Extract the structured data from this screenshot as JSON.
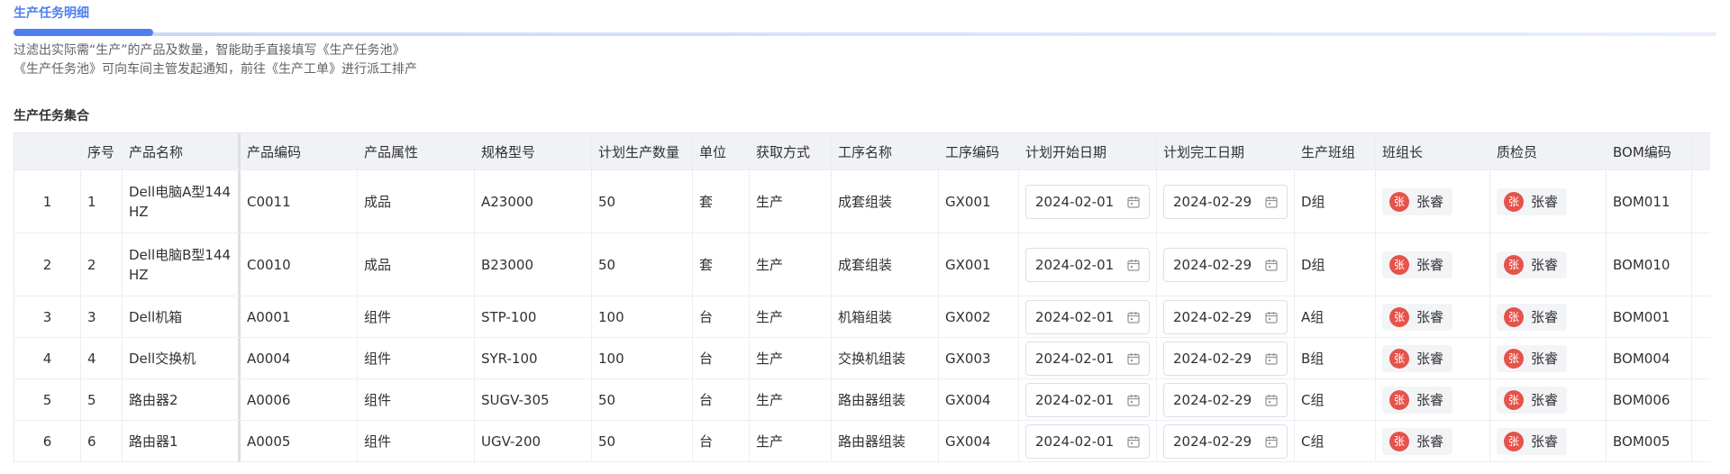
{
  "tab": {
    "title": "生产任务明细"
  },
  "description": {
    "line1": "过滤出实际需“生产”的产品及数量，智能助手直接填写《生产任务池》",
    "line2": "《生产任务池》可向车间主管发起通知，前往《生产工单》进行派工排产"
  },
  "section": {
    "title": "生产任务集合"
  },
  "table": {
    "headers": {
      "index": "",
      "seq": "序号",
      "product_name": "产品名称",
      "product_code": "产品编码",
      "product_attr": "产品属性",
      "spec": "规格型号",
      "plan_qty": "计划生产数量",
      "unit": "单位",
      "acquire": "获取方式",
      "process_name": "工序名称",
      "process_code": "工序编码",
      "plan_start": "计划开始日期",
      "plan_end": "计划完工日期",
      "team": "生产班组",
      "leader": "班组长",
      "inspector": "质检员",
      "bom": "BOM编码"
    },
    "rows": [
      {
        "index": "1",
        "seq": "1",
        "product_name": "Dell电脑A型144HZ",
        "product_code": "C0011",
        "product_attr": "成品",
        "spec": "A23000",
        "plan_qty": "50",
        "unit": "套",
        "acquire": "生产",
        "process_name": "成套组装",
        "process_code": "GX001",
        "plan_start": "2024-02-01",
        "plan_end": "2024-02-29",
        "team": "D组",
        "leader": "张睿",
        "leader_avatar": "张",
        "inspector": "张睿",
        "inspector_avatar": "张",
        "bom": "BOM011"
      },
      {
        "index": "2",
        "seq": "2",
        "product_name": "Dell电脑B型144HZ",
        "product_code": "C0010",
        "product_attr": "成品",
        "spec": "B23000",
        "plan_qty": "50",
        "unit": "套",
        "acquire": "生产",
        "process_name": "成套组装",
        "process_code": "GX001",
        "plan_start": "2024-02-01",
        "plan_end": "2024-02-29",
        "team": "D组",
        "leader": "张睿",
        "leader_avatar": "张",
        "inspector": "张睿",
        "inspector_avatar": "张",
        "bom": "BOM010"
      },
      {
        "index": "3",
        "seq": "3",
        "product_name": "Dell机箱",
        "product_code": "A0001",
        "product_attr": "组件",
        "spec": "STP-100",
        "plan_qty": "100",
        "unit": "台",
        "acquire": "生产",
        "process_name": "机箱组装",
        "process_code": "GX002",
        "plan_start": "2024-02-01",
        "plan_end": "2024-02-29",
        "team": "A组",
        "leader": "张睿",
        "leader_avatar": "张",
        "inspector": "张睿",
        "inspector_avatar": "张",
        "bom": "BOM001"
      },
      {
        "index": "4",
        "seq": "4",
        "product_name": "Dell交换机",
        "product_code": "A0004",
        "product_attr": "组件",
        "spec": "SYR-100",
        "plan_qty": "100",
        "unit": "台",
        "acquire": "生产",
        "process_name": "交换机组装",
        "process_code": "GX003",
        "plan_start": "2024-02-01",
        "plan_end": "2024-02-29",
        "team": "B组",
        "leader": "张睿",
        "leader_avatar": "张",
        "inspector": "张睿",
        "inspector_avatar": "张",
        "bom": "BOM004"
      },
      {
        "index": "5",
        "seq": "5",
        "product_name": "路由器2",
        "product_code": "A0006",
        "product_attr": "组件",
        "spec": "SUGV-305",
        "plan_qty": "50",
        "unit": "台",
        "acquire": "生产",
        "process_name": "路由器组装",
        "process_code": "GX004",
        "plan_start": "2024-02-01",
        "plan_end": "2024-02-29",
        "team": "C组",
        "leader": "张睿",
        "leader_avatar": "张",
        "inspector": "张睿",
        "inspector_avatar": "张",
        "bom": "BOM006"
      },
      {
        "index": "6",
        "seq": "6",
        "product_name": "路由器1",
        "product_code": "A0005",
        "product_attr": "组件",
        "spec": "UGV-200",
        "plan_qty": "50",
        "unit": "台",
        "acquire": "生产",
        "process_name": "路由器组装",
        "process_code": "GX004",
        "plan_start": "2024-02-01",
        "plan_end": "2024-02-29",
        "team": "C组",
        "leader": "张睿",
        "leader_avatar": "张",
        "inspector": "张睿",
        "inspector_avatar": "张",
        "bom": "BOM005"
      }
    ]
  },
  "icons": {
    "date": "calendar-icon"
  },
  "colors": {
    "accent": "#4e7ef0",
    "avatar": "#e5534b"
  }
}
